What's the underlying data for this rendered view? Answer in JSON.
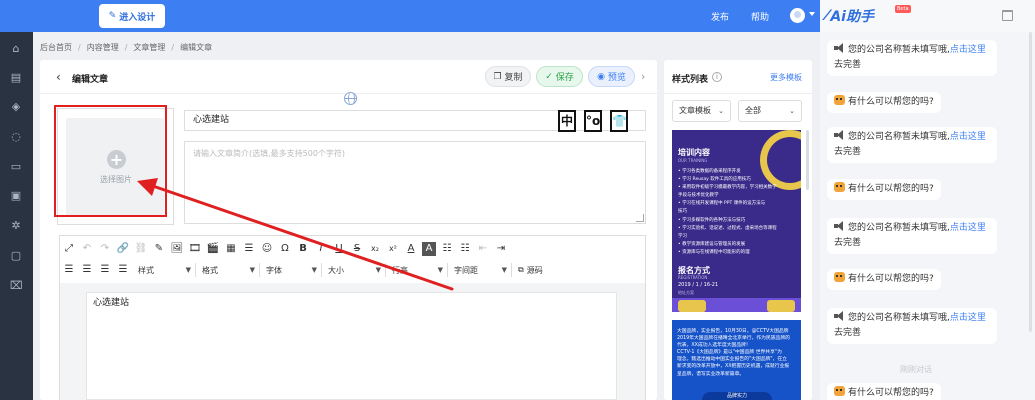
{
  "topbar": {
    "design_button": "进入设计",
    "publish": "发布",
    "help": "帮助"
  },
  "breadcrumb": [
    "后台首页",
    "内容管理",
    "文章管理",
    "编辑文章"
  ],
  "page": {
    "title": "编辑文章",
    "copy": "复制",
    "save": "保存",
    "preview": "预览"
  },
  "picker": {
    "label": "选择图片"
  },
  "article": {
    "title_value": "心选建站",
    "summary_placeholder": "请输入文章简介(选填,最多支持500个字符)",
    "body": "心选建站",
    "title_tools": [
      "中",
      "°o",
      "👕"
    ]
  },
  "editor": {
    "row1": [
      "⤢",
      "↶",
      "↷",
      "🔗",
      "⛓",
      "✎",
      "🖼",
      "🎞",
      "🎬",
      "▦",
      "☰",
      "☺",
      "Ω",
      "B",
      "I",
      "U",
      "S",
      "x₂",
      "x²",
      "A",
      "A",
      "☷",
      "☷",
      "⇤",
      "⇥"
    ],
    "row2_icons": [
      "☰",
      "☰",
      "☰",
      "☰"
    ],
    "selects": [
      "样式",
      "格式",
      "字体",
      "大小",
      "行高",
      "字间距"
    ],
    "source": "源码"
  },
  "style_panel": {
    "title": "样式列表",
    "more": "更多模板",
    "select_1": "文章模板",
    "select_2": "全部",
    "tpl1": {
      "heading": "培训内容",
      "sub": "OUR TRAINING",
      "items": [
        "• 学习各类数据的备采程序开发",
        "• 学习 Reusay 软件工具的应用技巧",
        "• 采用软件初级学习模最教学内容，学习相关数学",
        "  手段与技术优化教学",
        "• 学习在线开发课程中 PPT 课件的设方法与",
        "  技巧",
        "• 学习多媒软件的各种方法与技巧",
        "• 学习实验机、话说述、过程式、虚采场合等课程",
        "  学习",
        "• 教学资源库建设与管理员的发展",
        "• 资源库与在线课程中可能形的的理"
      ],
      "heading2": "报名方式",
      "sub2": "REGISTRATION",
      "date": "2019 / 1 / 16-21",
      "addr": "地址方案"
    },
    "tpl2": {
      "lines": [
        "大国品牌，实业报告，10月30日，@CCTV大国品牌",
        "2019年大国品牌在播晴全北京举行，作为民族品牌的",
        "代表，XX成功入选年度大国品牌！",
        "CCTV-1《大国品牌》是以\"中国品牌 世界共享\"为",
        "理念，甄选出推动中国实业报告的\"大国品牌\"，在立",
        "新求变的改革开放中，XX把握历史机遇，成就行业报",
        "呈品牌，谱写实业改革新篇章。"
      ],
      "foot": "品牌实力"
    }
  },
  "ai": {
    "title": "Ai助手",
    "badge": "Beta",
    "messages": [
      {
        "type": "notice",
        "text": "您的公司名称暂未填写哦,",
        "link": "点击这里",
        "tail": "去完善"
      },
      {
        "type": "bot",
        "text": "有什么可以帮您的吗?"
      },
      {
        "type": "notice",
        "text": "您的公司名称暂未填写哦,",
        "link": "点击这里",
        "tail": "去完善"
      },
      {
        "type": "bot",
        "text": "有什么可以帮您的吗?"
      },
      {
        "type": "notice",
        "text": "您的公司名称暂未填写哦,",
        "link": "点击这里",
        "tail": "去完善"
      },
      {
        "type": "bot",
        "text": "有什么可以帮您的吗?"
      },
      {
        "type": "notice",
        "text": "您的公司名称暂未填写哦,",
        "link": "点击这里",
        "tail": "去完善"
      },
      {
        "type": "bot",
        "text": "有什么可以帮您的吗?"
      }
    ],
    "timestamp": "刚刚对话"
  },
  "colors": {
    "accent": "#3d7ff3",
    "sidebar": "#2a3341",
    "annotation": "#e02020",
    "save": "#2ea44f"
  }
}
